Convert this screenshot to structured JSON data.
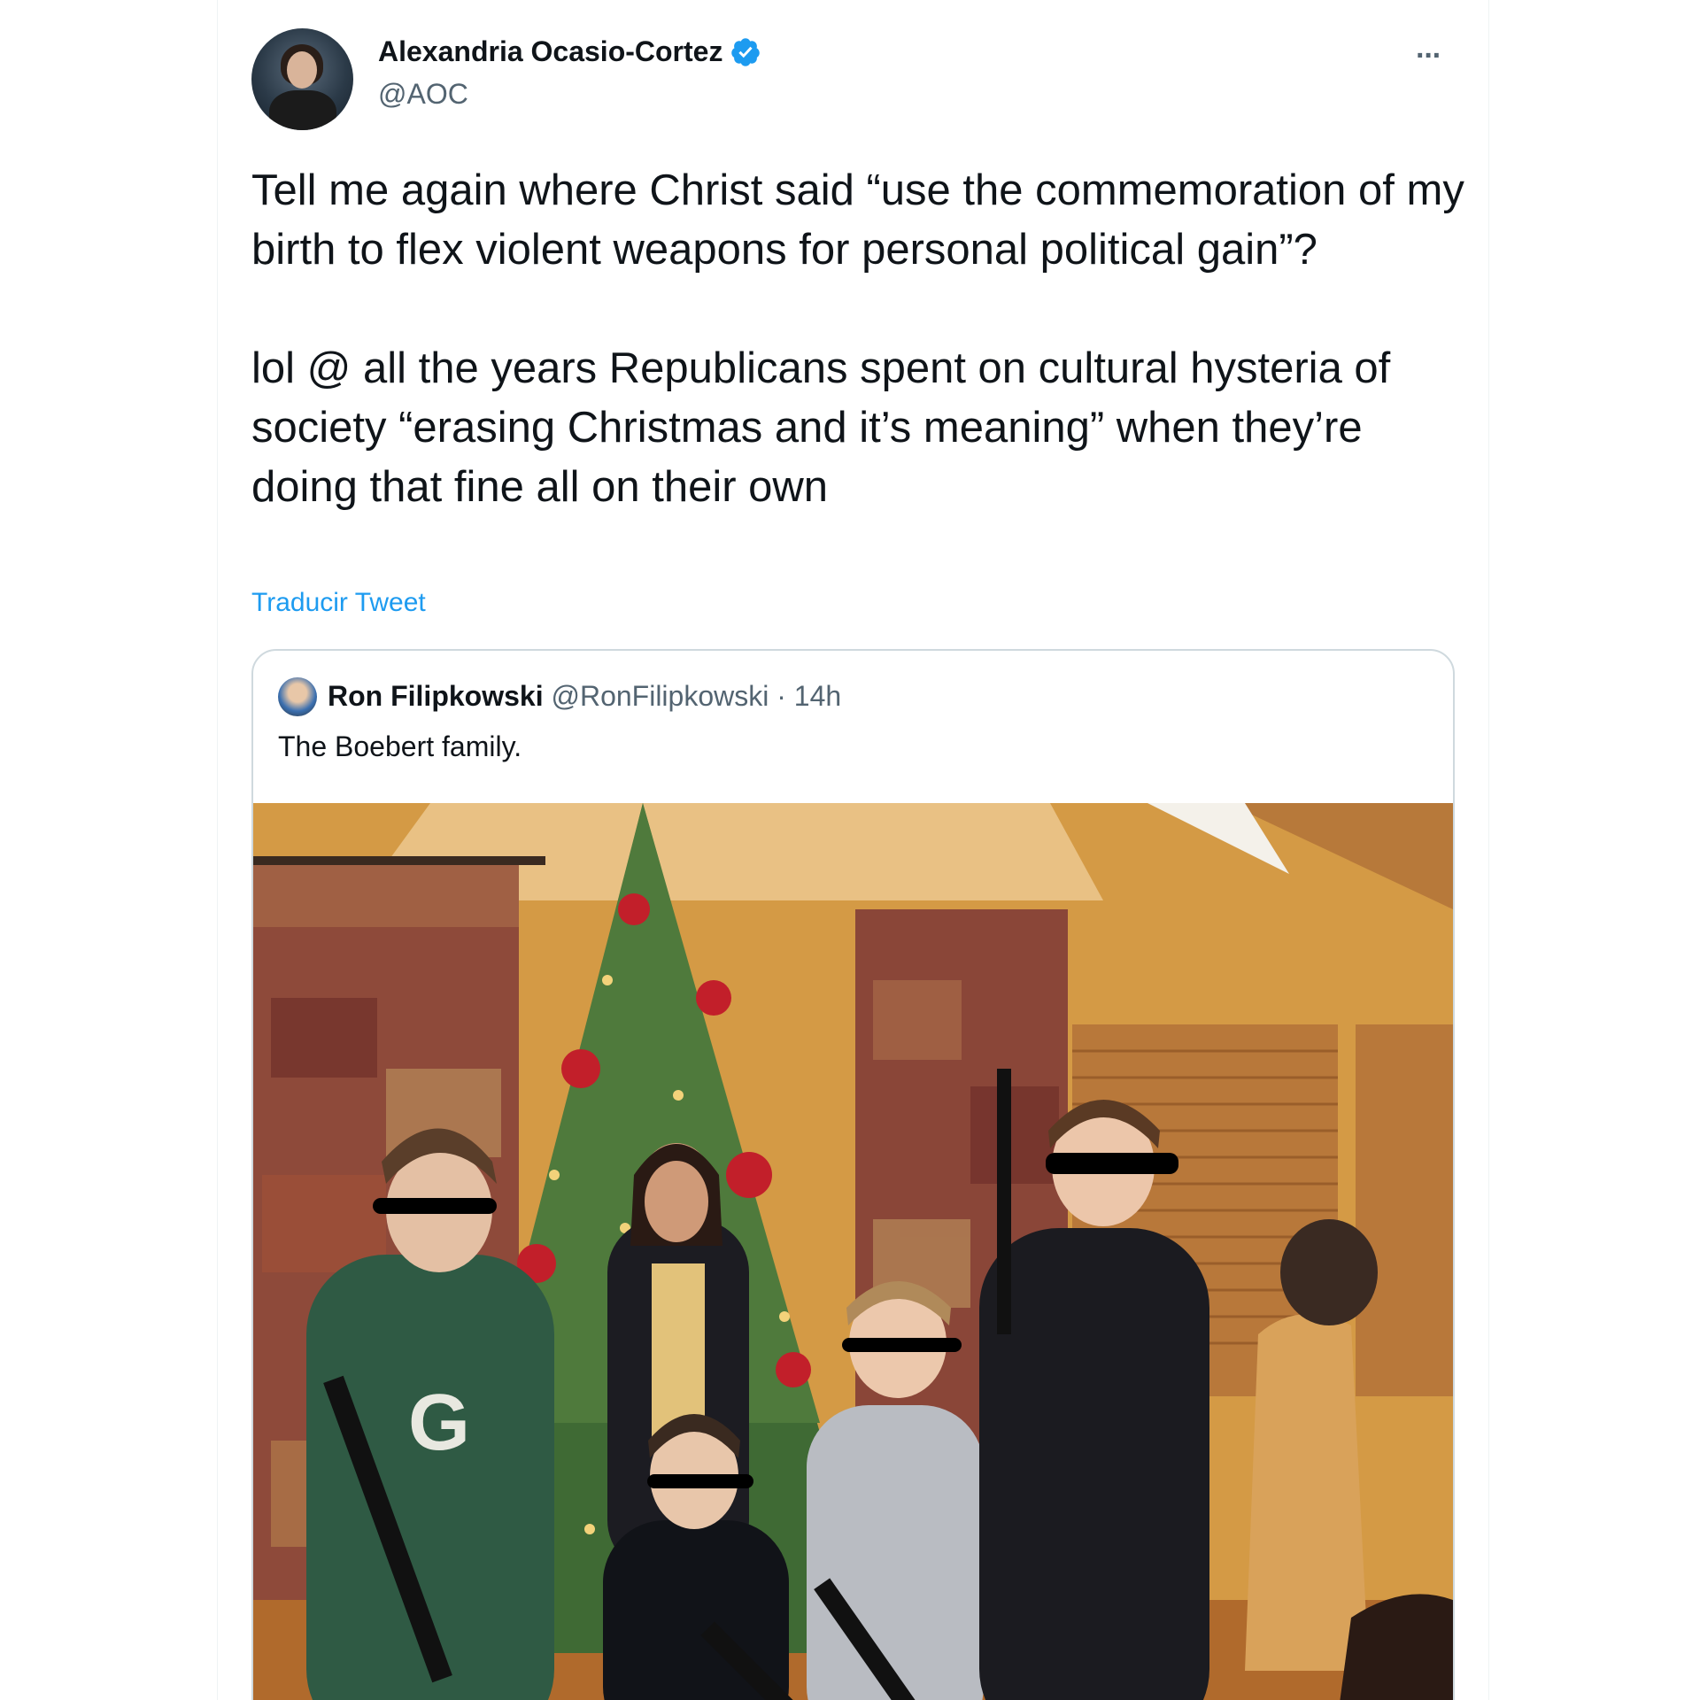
{
  "tweet": {
    "author_name": "Alexandria Ocasio-Cortez",
    "handle": "@AOC",
    "more_label": "···",
    "text": "Tell me again where Christ said “use the commemoration of my birth to flex violent weapons for personal political gain”?\n\nlol @ all the years Republicans spent on cultural hysteria of society “erasing Christmas and it’s meaning” when they’re doing that fine all on their own",
    "translate_label": "Traducir Tweet"
  },
  "quoted_tweet": {
    "author_name": "Ron Filipkowski",
    "handle": "@RonFilipkowski",
    "separator": "·",
    "time": "14h",
    "text": "The Boebert family."
  },
  "colors": {
    "accent": "#1d9bf0",
    "text_primary": "#0f1419",
    "text_secondary": "#536471",
    "border": "#cfd9de"
  },
  "icons": {
    "verified": "verified-badge-icon",
    "more": "more-options-icon"
  }
}
